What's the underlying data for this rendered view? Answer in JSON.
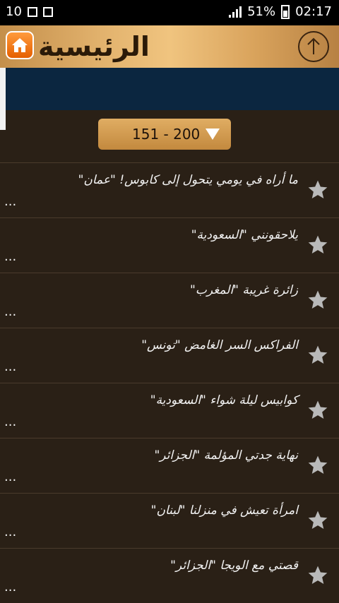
{
  "status_bar": {
    "notification_count": "10",
    "battery_percent": "51%",
    "time": "02:17"
  },
  "header": {
    "title": "الرئيسية"
  },
  "range_selector": {
    "value": "151 - 200"
  },
  "list": {
    "items": [
      {
        "title": "ما أراه في يومي يتحول إلى كابوس! \"عمان\"",
        "suffix": "..."
      },
      {
        "title": "يلاحقونني \"السعودية\"",
        "suffix": "..."
      },
      {
        "title": "زائرة غريبة \"المغرب\"",
        "suffix": "..."
      },
      {
        "title": "الفراكس السر الغامض \"تونس\"",
        "suffix": "..."
      },
      {
        "title": "كوابيس ليلة شواء \"السعودية\"",
        "suffix": "..."
      },
      {
        "title": "نهاية جدتي المؤلمة \"الجزائر\"",
        "suffix": "..."
      },
      {
        "title": "امرأة تعيش في منزلنا \"لبنان\"",
        "suffix": "..."
      },
      {
        "title": "قصتي مع الويجا \"الجزائر\"",
        "suffix": "..."
      }
    ]
  },
  "colors": {
    "header_gradient": "#e2b26d",
    "banner": "#0b2640",
    "background": "#2a2016",
    "home_button": "#ff9b3d"
  }
}
